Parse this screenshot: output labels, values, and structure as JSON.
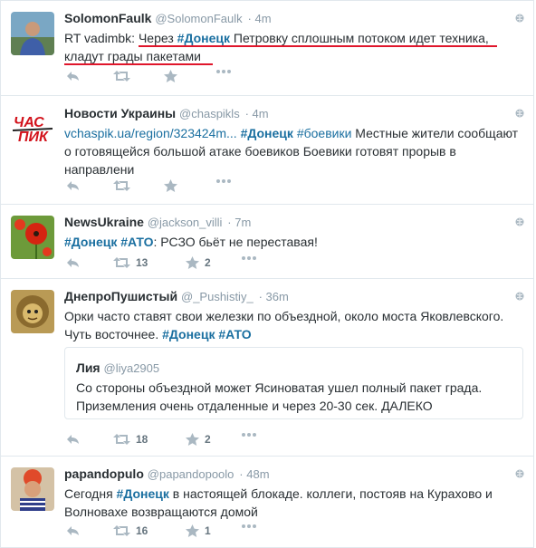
{
  "tweets": [
    {
      "name": "SolomonFaulk",
      "handle": "@SolomonFaulk",
      "time": "· 4m",
      "text_prefix": "RT vadimbk: ",
      "text_pre_hash": "Через ",
      "hashtag": "#Донецк",
      "text_rest": " Петровку сплошным потоком идет техника, кладут грады пакетами",
      "retweets": "",
      "favorites": ""
    },
    {
      "name": "Новости Украины",
      "handle": "@chaspikls",
      "time": "· 4m",
      "link": "vchaspik.ua/region/323424m...",
      "hashtag1": "#Донецк",
      "hashtag2": "#боевики",
      "text_rest": "  Местные жители сообщают о готовящейся большой атаке боевиков Боевики готовят прорыв в направлени",
      "logo_text": "ЧАС ПИК"
    },
    {
      "name": "NewsUkraine",
      "handle": "@jackson_villi",
      "time": "· 7m",
      "hashtag1": "#Донецк",
      "hashtag2": "#АТО",
      "text_rest": ": РСЗО бьёт не переставая!",
      "retweets": "13",
      "favorites": "2"
    },
    {
      "name": "ДнепроПушистый",
      "handle": "@_Pushistiy_",
      "time": "· 36m",
      "text_main": "Орки часто ставят свои железки по объездной, около моста Яковлевского. Чуть восточнее. ",
      "hashtag1": "#Донецк",
      "hashtag2": "#АТО",
      "retweets": "18",
      "favorites": "2",
      "quote": {
        "name": "Лия",
        "handle": "@liya2905",
        "text": "Со стороны объездной может Ясиноватая ушел полный пакет града. Приземления очень отдаленные и через 20-30 сек. ДАЛЕКО"
      }
    },
    {
      "name": "papandopulo",
      "handle": "@papandopoolo",
      "time": "· 48m",
      "text_pre_hash": "Сегодня ",
      "hashtag": "#Донецк",
      "text_rest": " в настоящей блокаде. коллеги, постояв на Курахово и Волновахе возвращаются домой",
      "retweets": "16",
      "favorites": "1"
    }
  ],
  "colors": {
    "hashtag": "#1a6fa0",
    "highlight": "#e0162b",
    "muted": "#8899a6"
  },
  "icons": [
    "reply-icon",
    "retweet-icon",
    "favorite-icon",
    "globe-icon"
  ]
}
